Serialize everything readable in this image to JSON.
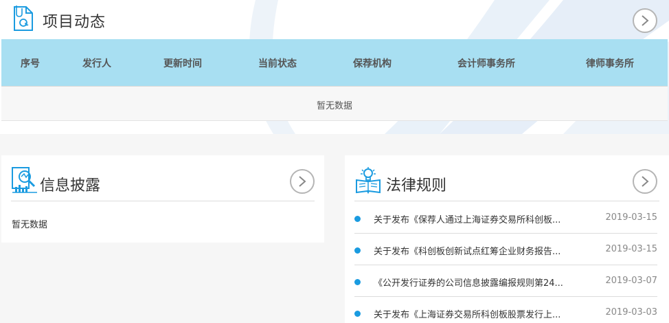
{
  "project": {
    "title": "项目动态",
    "columns": [
      "序号",
      "发行人",
      "更新时间",
      "当前状态",
      "保荐机构",
      "会计师事务所",
      "律师事务所"
    ],
    "empty_text": "暂无数据"
  },
  "disclosure": {
    "title": "信息披露",
    "empty_text": "暂无数据"
  },
  "rules": {
    "title": "法律规则",
    "items": [
      {
        "title": "关于发布《保荐人通过上海证券交易所科创板...",
        "date": "2019-03-15"
      },
      {
        "title": "关于发布《科创板创新试点红筹企业财务报告...",
        "date": "2019-03-15"
      },
      {
        "title": "《公开发行证券的公司信息披露编报规则第24...",
        "date": "2019-03-07"
      },
      {
        "title": "关于发布《上海证券交易所科创板股票发行上...",
        "date": "2019-03-03"
      }
    ]
  },
  "icons": {
    "project": "document-email-icon",
    "disclosure": "magnifier-chart-icon",
    "rules": "lightbulb-book-icon",
    "more": "chevron-right-circle-icon"
  },
  "colors": {
    "accent": "#1a9be0",
    "table_header": "#a8dff2",
    "page_bg": "#f6f6f6"
  }
}
